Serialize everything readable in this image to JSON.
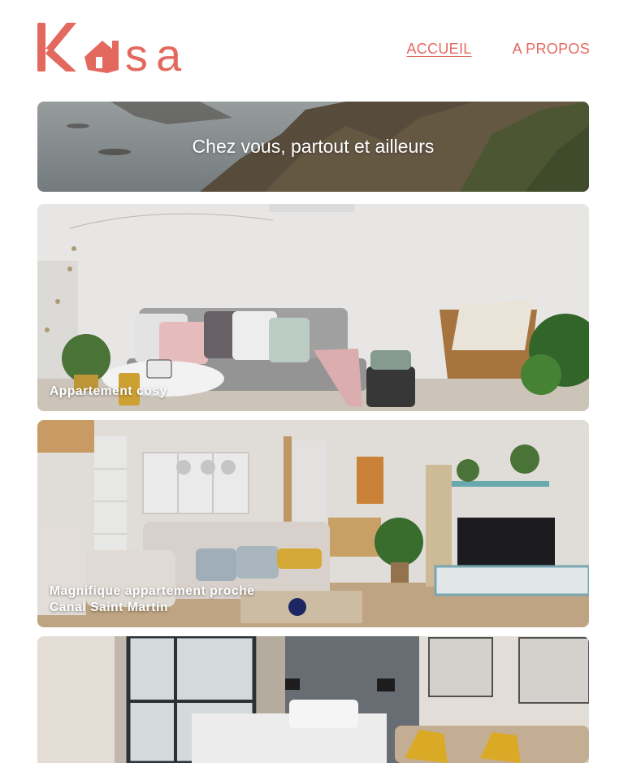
{
  "brand": {
    "name": "Kasa",
    "color": "#e3695f"
  },
  "nav": {
    "items": [
      {
        "label": "ACCUEIL",
        "active": true
      },
      {
        "label": "A PROPOS",
        "active": false
      }
    ]
  },
  "banner": {
    "title": "Chez vous, partout et ailleurs"
  },
  "listings": [
    {
      "title": "Appartement cosy"
    },
    {
      "title": "Magnifique appartement proche\nCanal Saint Martin"
    },
    {
      "title": ""
    }
  ]
}
